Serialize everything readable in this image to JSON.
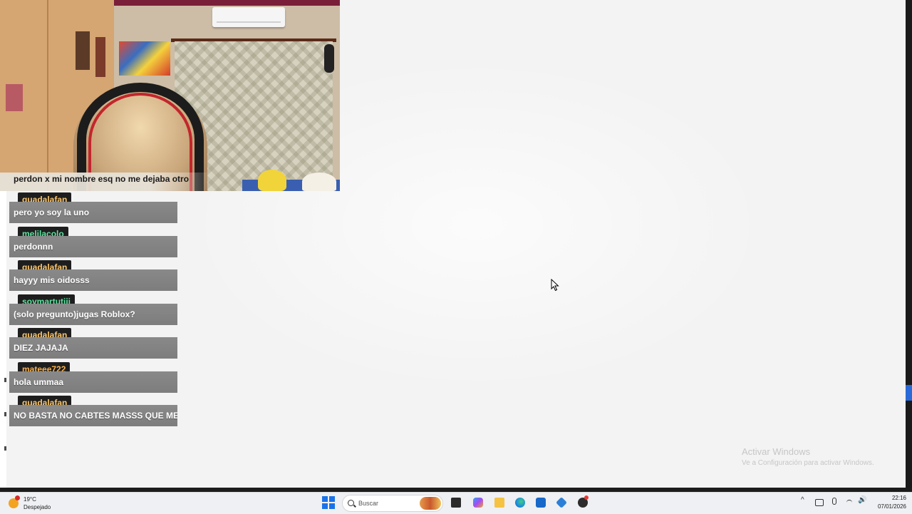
{
  "overlay": {
    "webcam_message": "perdon x mi nombre esq no me dejaba otro"
  },
  "chat": {
    "messages": [
      {
        "user": "guadalafan",
        "text": "pero yo soy la uno"
      },
      {
        "user": "melilacolo",
        "text": "perdonnn"
      },
      {
        "user": "guadalafan",
        "text": "hayyy mis oidosss"
      },
      {
        "user": "soymartutiii",
        "text": "(solo pregunto)jugas Roblox?"
      },
      {
        "user": "guadalafan",
        "text": "DIEZ JAJAJA"
      },
      {
        "user": "mateee722",
        "text": "hola ummaa"
      },
      {
        "user": "guadalafan",
        "text": "NO BASTA NO CABTES MASSS QUE ME D"
      }
    ],
    "colors": {
      "gold": "#fdc86e",
      "green": "#5fe3a0",
      "orange": "#f6b253",
      "message_bg": "#808080"
    }
  },
  "watermark": {
    "title": "Activar Windows",
    "subtitle": "Ve a Configuración para activar Windows."
  },
  "taskbar": {
    "weather": {
      "temp": "19°C",
      "condition": "Despejado",
      "icon": "sun-icon"
    },
    "search_placeholder": "Buscar",
    "apps": [
      "task-view-icon",
      "copilot-icon",
      "file-explorer-icon",
      "edge-icon",
      "store-icon",
      "vscode-icon",
      "obs-icon"
    ],
    "tray": {
      "chevron": "^",
      "volume": "🔊"
    },
    "clock": {
      "time": "22:16",
      "date": "07/01/2026"
    }
  }
}
